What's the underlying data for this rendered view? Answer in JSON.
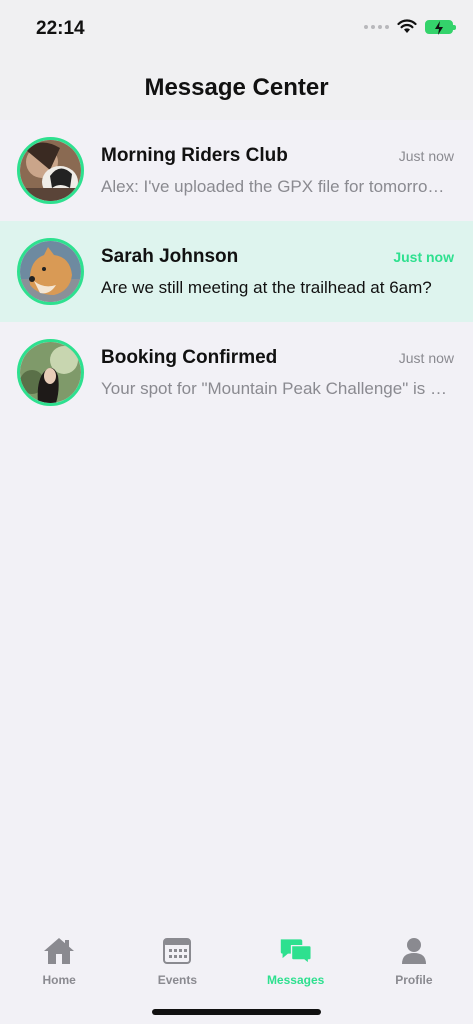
{
  "status_bar": {
    "time": "22:14"
  },
  "header": {
    "title": "Message Center"
  },
  "conversations": [
    {
      "title": "Morning Riders Club",
      "time": "Just now",
      "preview": "Alex: I've uploaded the GPX file for tomorrow's ride",
      "unread": false
    },
    {
      "title": "Sarah Johnson",
      "time": "Just now",
      "preview": "Are we still meeting at the trailhead at 6am?",
      "unread": true
    },
    {
      "title": "Booking Confirmed",
      "time": "Just now",
      "preview": "Your spot for \"Mountain Peak Challenge\" is confirmed",
      "unread": false
    }
  ],
  "tabbar": {
    "items": [
      {
        "label": "Home",
        "icon": "house-icon"
      },
      {
        "label": "Events",
        "icon": "calendar-icon"
      },
      {
        "label": "Messages",
        "icon": "chat-bubbles-icon"
      },
      {
        "label": "Profile",
        "icon": "person-icon"
      }
    ],
    "active": "Messages"
  },
  "colors": {
    "accent": "#2ee08f",
    "active_row": "#def4ee",
    "muted": "#8a8a90",
    "background": "#f2f1f6"
  }
}
